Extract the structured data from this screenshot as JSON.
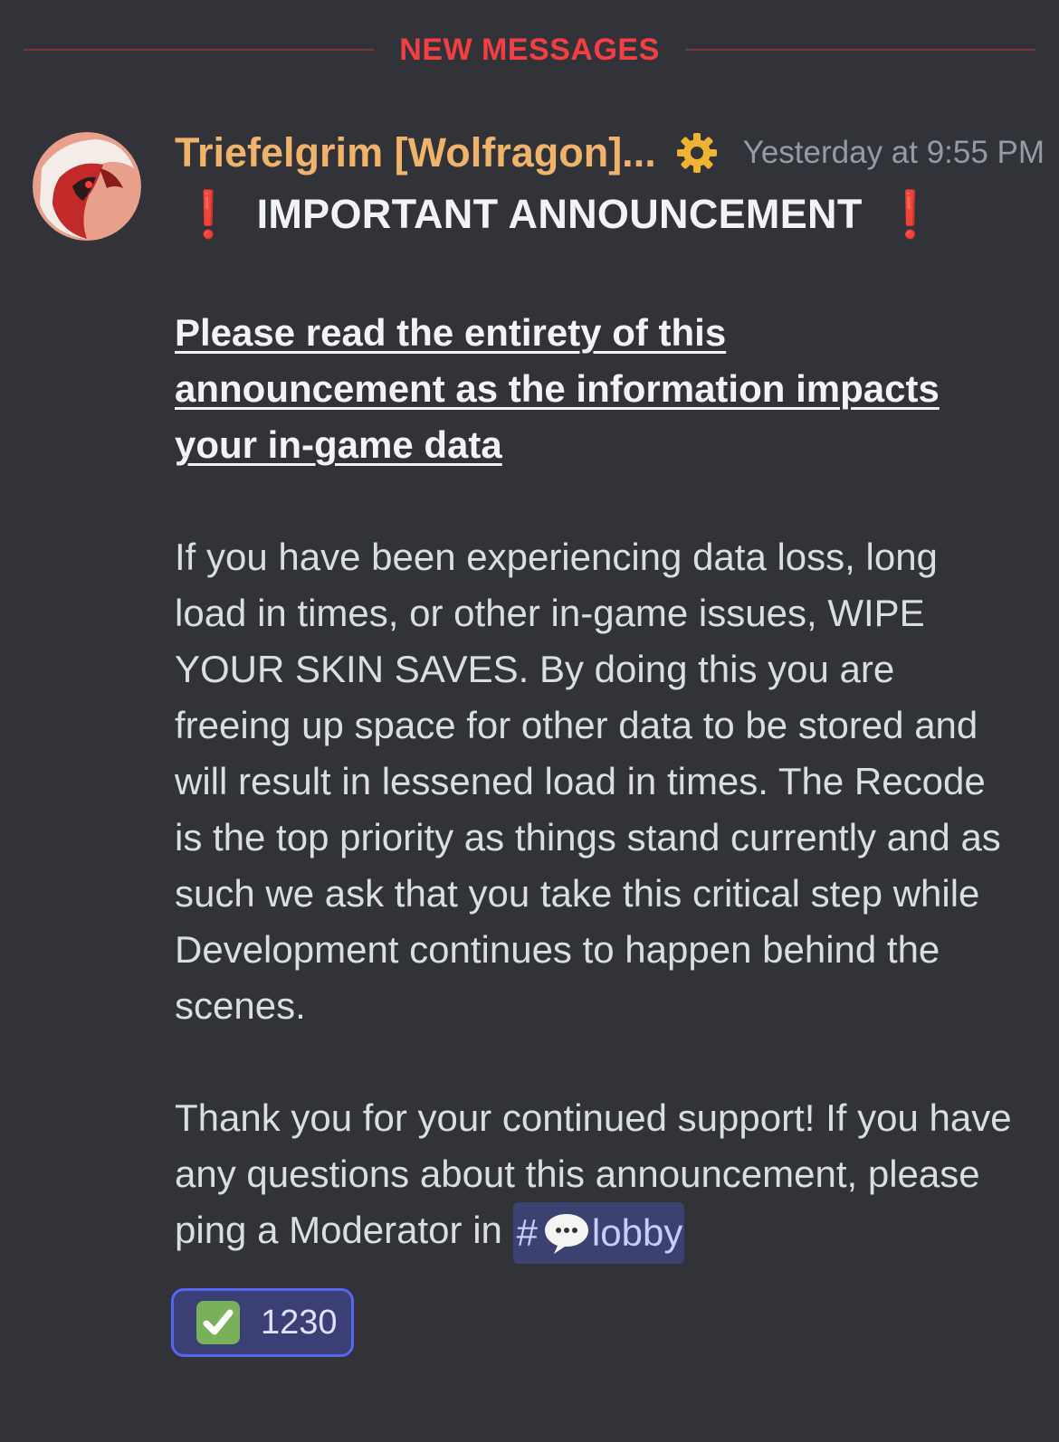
{
  "divider": {
    "label": "NEW MESSAGES"
  },
  "message": {
    "author": "Triefelgrim [Wolfragon]...",
    "role_icon": "gear-icon",
    "timestamp": "Yesterday at 9:55 PM",
    "headline": {
      "emoji_left": "❗",
      "text": "IMPORTANT ANNOUNCEMENT",
      "emoji_right": "❗"
    },
    "subhead": "Please read the entirety of this announcement as the information impacts your in-game data",
    "paragraph1": "If you have been experiencing data loss, long load in times, or other in-game issues, WIPE YOUR SKIN SAVES. By doing this you are freeing up space for other data to be stored and will result in lessened load in times. The Recode is the top priority as things stand currently and as such we ask that you take this critical step while Development continues to happen behind the scenes.",
    "paragraph2_prefix": "Thank you for your continued support! If you have any questions about this announcement, please ping a Moderator in ",
    "channel": {
      "hash": "#",
      "icon": "speech-bubble-icon",
      "name": "lobby"
    }
  },
  "reaction": {
    "emoji": "check-mark-icon",
    "count": "1230"
  },
  "colors": {
    "background": "#313338",
    "new_messages_red": "#f23f43",
    "username": "#f0b36b",
    "mention_bg": "#3c4270",
    "reaction_border": "#5865f2"
  }
}
